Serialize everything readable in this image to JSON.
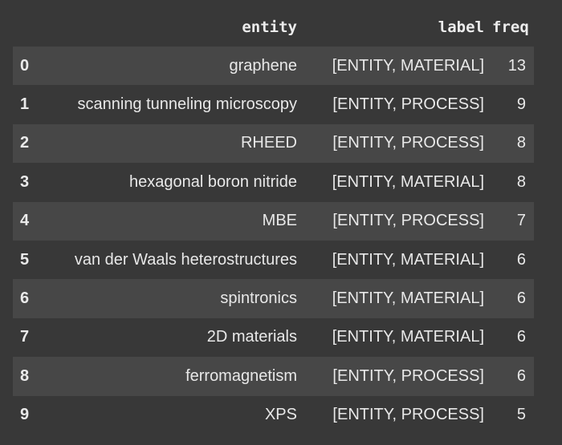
{
  "table": {
    "columns": {
      "index": "",
      "entity": "entity",
      "label": "label",
      "freq": "freq"
    },
    "rows": [
      {
        "index": "0",
        "entity": "graphene",
        "label": "[ENTITY, MATERIAL]",
        "freq": "13"
      },
      {
        "index": "1",
        "entity": "scanning tunneling microscopy",
        "label": "[ENTITY, PROCESS]",
        "freq": "9"
      },
      {
        "index": "2",
        "entity": "RHEED",
        "label": "[ENTITY, PROCESS]",
        "freq": "8"
      },
      {
        "index": "3",
        "entity": "hexagonal boron nitride",
        "label": "[ENTITY, MATERIAL]",
        "freq": "8"
      },
      {
        "index": "4",
        "entity": "MBE",
        "label": "[ENTITY, PROCESS]",
        "freq": "7"
      },
      {
        "index": "5",
        "entity": "van der Waals heterostructures",
        "label": "[ENTITY, MATERIAL]",
        "freq": "6"
      },
      {
        "index": "6",
        "entity": "spintronics",
        "label": "[ENTITY, MATERIAL]",
        "freq": "6"
      },
      {
        "index": "7",
        "entity": "2D materials",
        "label": "[ENTITY, MATERIAL]",
        "freq": "6"
      },
      {
        "index": "8",
        "entity": "ferromagnetism",
        "label": "[ENTITY, PROCESS]",
        "freq": "6"
      },
      {
        "index": "9",
        "entity": "XPS",
        "label": "[ENTITY, PROCESS]",
        "freq": "5"
      }
    ]
  },
  "colors": {
    "background": "#383838",
    "row_stripe": "#474747",
    "text": "#e6e6e6"
  }
}
